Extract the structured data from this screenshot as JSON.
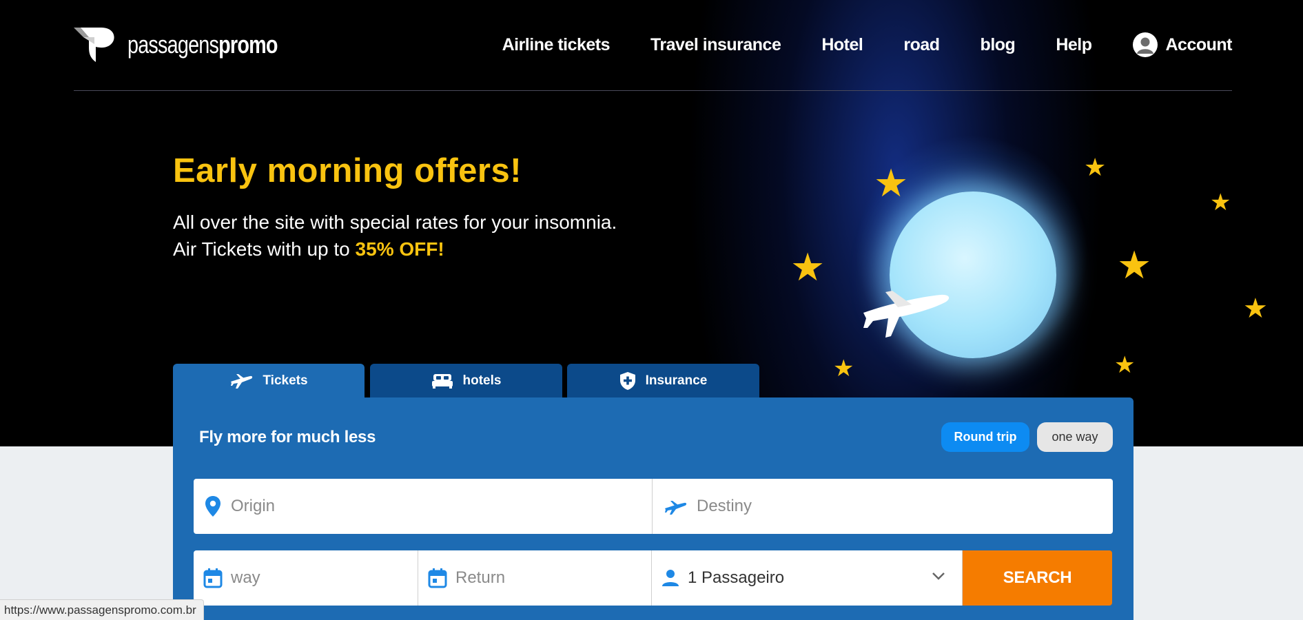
{
  "header": {
    "logo_light": "passagens",
    "logo_bold": "promo",
    "nav": [
      "Airline tickets",
      "Travel insurance",
      "Hotel",
      "road",
      "blog",
      "Help"
    ],
    "account_label": "Account"
  },
  "hero": {
    "headline": "Early morning offers!",
    "line1": "All over the site with special rates for your insomnia.",
    "line2_prefix": "Air Tickets with up to ",
    "line2_highlight": "35% OFF!"
  },
  "tabs": [
    {
      "label": "Tickets",
      "icon": "plane-icon",
      "active": true
    },
    {
      "label": "hotels",
      "icon": "bed-icon",
      "active": false
    },
    {
      "label": "Insurance",
      "icon": "shield-icon",
      "active": false
    }
  ],
  "search": {
    "title": "Fly more for much less",
    "trip_round": "Round trip",
    "trip_one": "one way",
    "origin_placeholder": "Origin",
    "destiny_placeholder": "Destiny",
    "way_placeholder": "way",
    "return_placeholder": "Return",
    "passengers": "1 Passageiro",
    "search_button": "SEARCH"
  },
  "status_bar": {
    "url": "https://www.passagenspromo.com.br"
  },
  "colors": {
    "accent_yellow": "#f9c310",
    "panel_blue": "#1d6bb3",
    "tab_dark_blue": "#0c4a8a",
    "search_orange": "#f57c00",
    "round_trip_blue": "#0d8bf2"
  }
}
